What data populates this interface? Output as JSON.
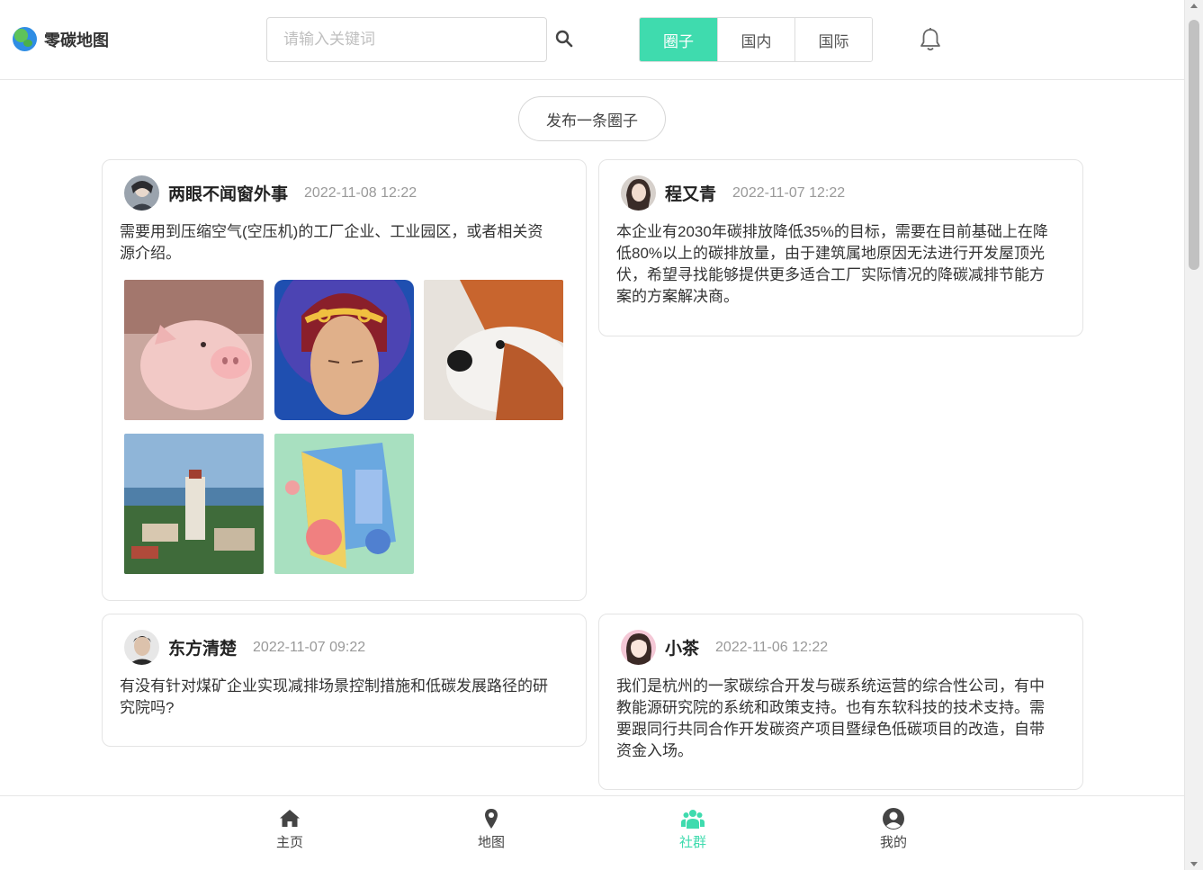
{
  "app": {
    "name": "零碳地图"
  },
  "search": {
    "placeholder": "请输入关键词"
  },
  "tabs": [
    {
      "label": "圈子",
      "active": true
    },
    {
      "label": "国内",
      "active": false
    },
    {
      "label": "国际",
      "active": false
    }
  ],
  "publish_label": "发布一条圈子",
  "posts": [
    {
      "user": "两眼不闻窗外事",
      "time": "2022-11-08 12:22",
      "content_lines": [
        "需要用到压缩空气(空压机)的工厂企业、工业园区，或者相关资",
        "源介绍。"
      ],
      "images": [
        "piglet-photo",
        "monkey-king-painting",
        "red-panda-photo",
        "city-tower-photo",
        "green-building-illustration"
      ]
    },
    {
      "user": "程又青",
      "time": "2022-11-07 12:22",
      "content_lines": [
        "本企业有2030年碳排放降低35%的目标，需要在目前基础上在降",
        "低80%以上的碳排放量，由于建筑属地原因无法进行开发屋顶光",
        "伏，希望寻找能够提供更多适合工厂实际情况的降碳减排节能方",
        "案的方案解决商。"
      ],
      "images": []
    },
    {
      "user": "东方清楚",
      "time": "2022-11-07 09:22",
      "content_lines": [
        "有没有针对煤矿企业实现减排场景控制措施和低碳发展路径的研",
        "究院吗?"
      ],
      "images": []
    },
    {
      "user": "小茶",
      "time": "2022-11-06 12:22",
      "content_lines": [
        "我们是杭州的一家碳综合开发与碳系统运营的综合性公司，有中",
        "教能源研究院的系统和政策支持。也有东软科技的技术支持。需",
        "要跟同行共同合作开发碳资产项目暨绿色低碳项目的改造，自带",
        "资金入场。"
      ],
      "images": []
    }
  ],
  "bottom_nav": [
    {
      "label": "主页",
      "icon": "home-icon",
      "active": false
    },
    {
      "label": "地图",
      "icon": "map-pin-icon",
      "active": false
    },
    {
      "label": "社群",
      "icon": "users-icon",
      "active": true
    },
    {
      "label": "我的",
      "icon": "user-circle-icon",
      "active": false
    }
  ],
  "colors": {
    "accent": "#3fdbae",
    "border": "#e4e4e4",
    "muted": "#999999"
  }
}
